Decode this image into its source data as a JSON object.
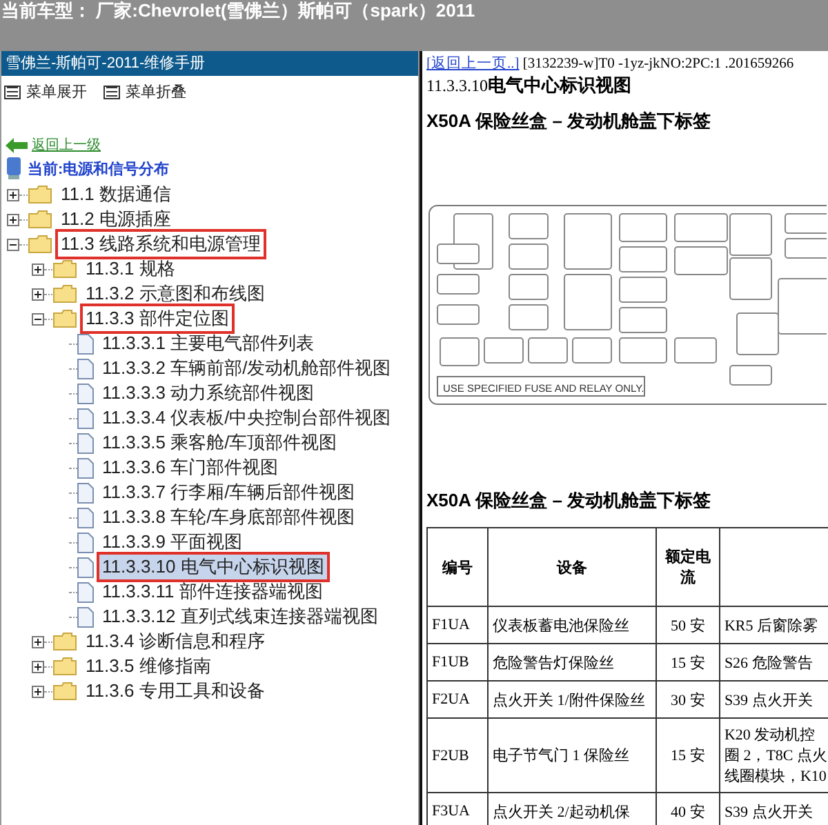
{
  "top_bar": {
    "title": "当前车型： 厂家:Chevrolet(雪佛兰）斯帕可（spark）2011"
  },
  "left_panel": {
    "title": "雪佛兰-斯帕可-2011-维修手册",
    "toolbar": [
      "菜单展开",
      "菜单折叠"
    ],
    "back_link": "返回上一级",
    "current": "当前:电源和信号分布",
    "tree": [
      {
        "kind": "folder",
        "label": "11.1 数据通信",
        "expanded": false,
        "selected": false,
        "highlighted": false
      },
      {
        "kind": "folder",
        "label": "11.2 电源插座",
        "expanded": false,
        "selected": false,
        "highlighted": false
      },
      {
        "kind": "folder",
        "label": "11.3 线路系统和电源管理",
        "expanded": true,
        "selected": false,
        "highlighted": true,
        "children": [
          {
            "kind": "folder",
            "label": "11.3.1 规格",
            "expanded": false,
            "selected": false,
            "highlighted": false
          },
          {
            "kind": "folder",
            "label": "11.3.2 示意图和布线图",
            "expanded": false,
            "selected": false,
            "highlighted": false
          },
          {
            "kind": "folder",
            "label": "11.3.3 部件定位图",
            "expanded": true,
            "selected": false,
            "highlighted": true,
            "children": [
              {
                "kind": "page",
                "label": "11.3.3.1 主要电气部件列表",
                "selected": false,
                "highlighted": false
              },
              {
                "kind": "page",
                "label": "11.3.3.2 车辆前部/发动机舱部件视图",
                "selected": false,
                "highlighted": false
              },
              {
                "kind": "page",
                "label": "11.3.3.3 动力系统部件视图",
                "selected": false,
                "highlighted": false
              },
              {
                "kind": "page",
                "label": "11.3.3.4 仪表板/中央控制台部件视图",
                "selected": false,
                "highlighted": false
              },
              {
                "kind": "page",
                "label": "11.3.3.5 乘客舱/车顶部件视图",
                "selected": false,
                "highlighted": false
              },
              {
                "kind": "page",
                "label": "11.3.3.6 车门部件视图",
                "selected": false,
                "highlighted": false
              },
              {
                "kind": "page",
                "label": "11.3.3.7 行李厢/车辆后部件视图",
                "selected": false,
                "highlighted": false
              },
              {
                "kind": "page",
                "label": "11.3.3.8 车轮/车身底部部件视图",
                "selected": false,
                "highlighted": false
              },
              {
                "kind": "page",
                "label": "11.3.3.9 平面视图",
                "selected": false,
                "highlighted": false
              },
              {
                "kind": "page",
                "label": "11.3.3.10 电气中心标识视图",
                "selected": true,
                "highlighted": true
              },
              {
                "kind": "page",
                "label": "11.3.3.11 部件连接器端视图",
                "selected": false,
                "highlighted": false
              },
              {
                "kind": "page",
                "label": "11.3.3.12 直列式线束连接器端视图",
                "selected": false,
                "highlighted": false
              }
            ]
          },
          {
            "kind": "folder",
            "label": "11.3.4 诊断信息和程序",
            "expanded": false,
            "selected": false,
            "highlighted": false
          },
          {
            "kind": "folder",
            "label": "11.3.5 维修指南",
            "expanded": false,
            "selected": false,
            "highlighted": false
          },
          {
            "kind": "folder",
            "label": "11.3.6 专用工具和设备",
            "expanded": false,
            "selected": false,
            "highlighted": false
          }
        ]
      }
    ]
  },
  "content": {
    "back_link": "[返回上一页..]",
    "doc_code": "[3132239-w]T0 -1yz-jkNO:2PC:1 .201659266",
    "section_number": "11.3.3.10",
    "section_title": "电气中心标识视图",
    "heading_1": "X50A 保险丝盒 – 发动机舱盖下标签",
    "diagram_notice": "USE SPECIFIED FUSE AND RELAY ONLY.",
    "heading_2": "X50A 保险丝盒 – 发动机舱盖下标签",
    "table": {
      "columns": [
        "编号",
        "设备",
        "额定电流",
        ""
      ],
      "rows": [
        [
          "F1UA",
          "仪表板蓄电池保险丝",
          "50 安",
          "KR5 后窗除雾"
        ],
        [
          "F1UB",
          "危险警告灯保险丝",
          "15 安",
          "S26 危险警告"
        ],
        [
          "F2UA",
          "点火开关 1/附件保险丝",
          "30 安",
          "S39 点火开关"
        ],
        [
          "F2UB",
          "电子节气门 1 保险丝",
          "15 安",
          [
            "K20 发动机控",
            "圈 2，T8C 点火",
            "线圈模块，K10"
          ]
        ],
        [
          "F3UA",
          "点火开关 2/起动机保",
          "40 安",
          "S39 点火开关"
        ]
      ]
    }
  }
}
